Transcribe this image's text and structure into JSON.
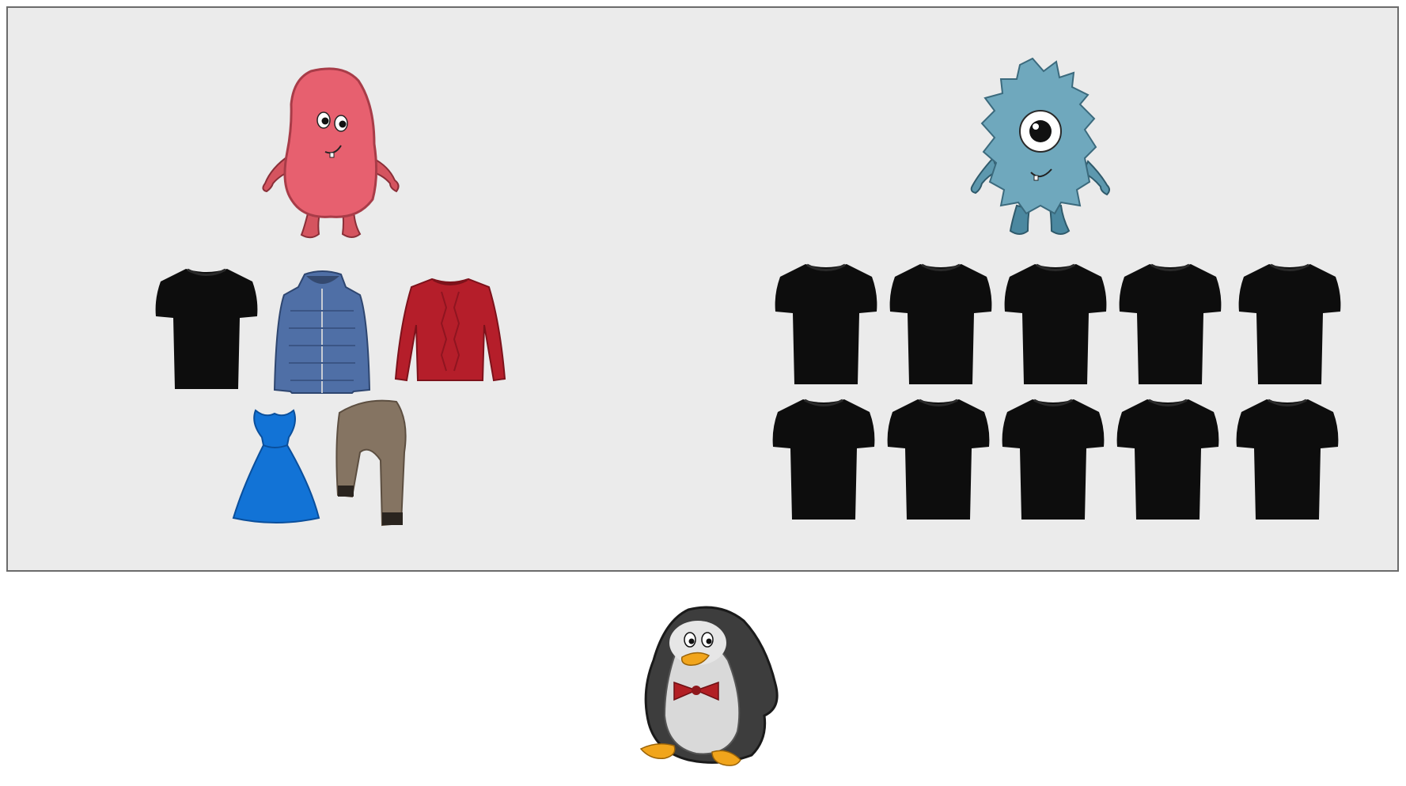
{
  "scene": {
    "panel_color": "#ebebeb",
    "panel_border_color": "#6b6b6b",
    "left_group": {
      "character": "pink-monster",
      "character_color": "#e7606f",
      "clothes": [
        "black-tshirt",
        "blue-puffer-jacket",
        "red-sweater",
        "blue-dress",
        "brown-scarf"
      ]
    },
    "right_group": {
      "character": "blue-cyclops-monster",
      "character_color": "#6fa8bd",
      "clothes": [
        "black-tshirt",
        "black-tshirt",
        "black-tshirt",
        "black-tshirt",
        "black-tshirt",
        "black-tshirt",
        "black-tshirt",
        "black-tshirt",
        "black-tshirt",
        "black-tshirt"
      ],
      "tshirt_count": 10
    },
    "bottom_character": "penguin-with-bowtie",
    "colors": {
      "tshirt": "#0d0d0d",
      "jacket": "#4f6fa6",
      "sweater": "#b51e2a",
      "dress": "#1273d6",
      "scarf": "#857462",
      "penguin_body": "#3d3d3d",
      "bowtie": "#b21f24",
      "beak": "#f1a51c"
    }
  }
}
